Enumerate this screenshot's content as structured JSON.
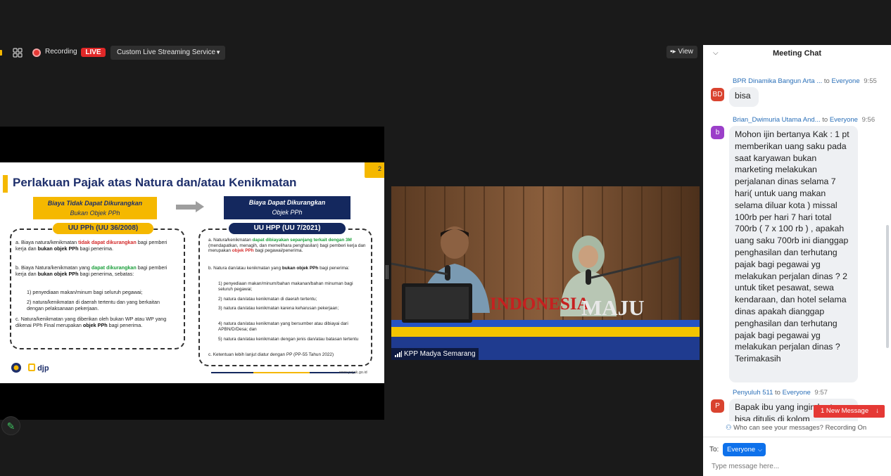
{
  "toolbar": {
    "recording_label": "Recording",
    "live_badge": "LIVE",
    "stream_service": "Custom Live Streaming Service",
    "view_label": "View"
  },
  "slide": {
    "page_number": "2",
    "title": "Perlakuan Pajak atas Natura dan/atau Kenikmatan",
    "left_header_line1": "Biaya Tidak Dapat Dikurangkan",
    "left_header_line2": "Bukan Objek PPh",
    "right_header_line1": "Biaya Dapat Dikurangkan",
    "right_header_line2": "Objek PPh",
    "left_pill": "UU PPh (UU 36/2008)",
    "right_pill": "UU HPP (UU 7/2021)",
    "left_a_1": "a.  Biaya natura/kenikmatan",
    "left_a_red": "tidak dapat dikurangkan",
    "left_a_2": "bagi pemberi kerja dan",
    "left_a_bold": "bukan objek PPh",
    "left_a_3": "bagi penerima.",
    "left_b_1": "b.  Biaya Natura/kenikmatan yang",
    "left_b_green": "dapat dikurangkan",
    "left_b_2": "bagi pemberi kerja dan",
    "left_b_bold": "bukan objek PPh",
    "left_b_3": "bagi penerima, sebatas:",
    "left_b1": "1)  penyediaan makan/minum bagi seluruh pegawai;",
    "left_b2": "2)  natura/kenikmatan di daerah tertentu dan yang berkaitan dengan pelaksanaan pekerjaan.",
    "left_c_1": "c.  Natura/kenikmatan yang diberikan oleh bukan WP atau WP yang dikenai PPh Final merupakan",
    "left_c_bold": "objek PPh",
    "left_c_2": "bagi penerima.",
    "right_a_1": "a.  Natura/kenikmatan",
    "right_a_green": "dapat dibiayakan sepanjang terkait dengan 3M",
    "right_a_2": "(mendapatkan, menagih, dan memelihara penghasilan) bagi pemberi kerja dan merupakan",
    "right_a_red": "objek PPh",
    "right_a_3": "bagi pegawai/penerima.",
    "right_b_1": "b.  Natura dan/atau kenikmatan yang",
    "right_b_bold": "bukan objek PPh",
    "right_b_2": "bagi penerima:",
    "right_b1": "1)  penyediaan makan/minum/bahan makanan/bahan minuman bagi seluruh pegawai;",
    "right_b2": "2)  natura dan/atau kenikmatan di daerah tertentu;",
    "right_b3": "3)  natura dan/atau kenikmatan karena keharusan pekerjaan;",
    "right_b4": "4)  natura dan/atau kenikmatan yang bersumber atau dibiayai dari APBN/D/Desa; dan",
    "right_b5": "5)  natura dan/atau kenikmatan dengan jenis dan/atau batasan tertentu",
    "right_c": "c.  Ketentuan lebih lanjut diatur dengan PP (PP-55 Tahun 2022)",
    "logo_text": "djp",
    "footer_url": "www.pajak.go.id"
  },
  "video": {
    "participant_name": "KPP Madya Semarang",
    "sign_left": "INDONESIA",
    "sign_right": "MAJU"
  },
  "chat": {
    "title": "Meeting Chat",
    "messages": [
      {
        "sender": "BPR Dinamika Bangun Arta ...",
        "to_word": "to",
        "recipient": "Everyone",
        "time": "9:55",
        "initials": "BD",
        "text": "bisa"
      },
      {
        "sender": "Brian_Dwimuria Utama And...",
        "to_word": "to",
        "recipient": "Everyone",
        "time": "9:56",
        "initials": "b",
        "text": "Mohon ijin bertanya Kak : 1 pt memberikan uang saku pada saat karyawan bukan marketing melakukan perjalanan dinas selama 7 hari( untuk uang makan selama diluar kota ) missal 100rb per hari 7 hari total 700rb ( 7 x 100 rb ) , apakah uang saku 700rb ini dianggap penghasilan dan terhutang pajak bagi pegawai yg melakukan perjalan dinas ? 2 untuk tiket pesawat, sewa kendaraan, dan hotel selama dinas apakah dianggap penghasilan dan terhutang pajak bagi pegawai yg melakukan perjalan dinas ? Terimakasih"
      },
      {
        "sender": "Penyuluh 511",
        "to_word": "to",
        "recipient": "Everyone",
        "time": "9:57",
        "initials": "P",
        "text": "Bapak ibu yang ingin bertanya bisa ditulis di kolom"
      }
    ],
    "new_message_label": "1 New Message",
    "visibility_notice": "Who can see your messages? Recording On",
    "to_label": "To:",
    "recipient_select": "Everyone",
    "input_placeholder": "Type message here..."
  },
  "colors": {
    "live_red": "#e02828",
    "accent_blue": "#0e71eb",
    "slide_yellow": "#f5b800",
    "slide_navy": "#14285e",
    "avatar_bd": "#d9432f",
    "avatar_b": "#9b3fc9",
    "avatar_p": "#d9432f"
  },
  "icons": {
    "grid": "grid-icon",
    "record": "record-dot-icon",
    "view": "view-icon",
    "collapse": "chevron-down-icon",
    "pencil": "pencil-icon",
    "arrow_down": "arrow-down-icon",
    "people": "people-icon"
  }
}
